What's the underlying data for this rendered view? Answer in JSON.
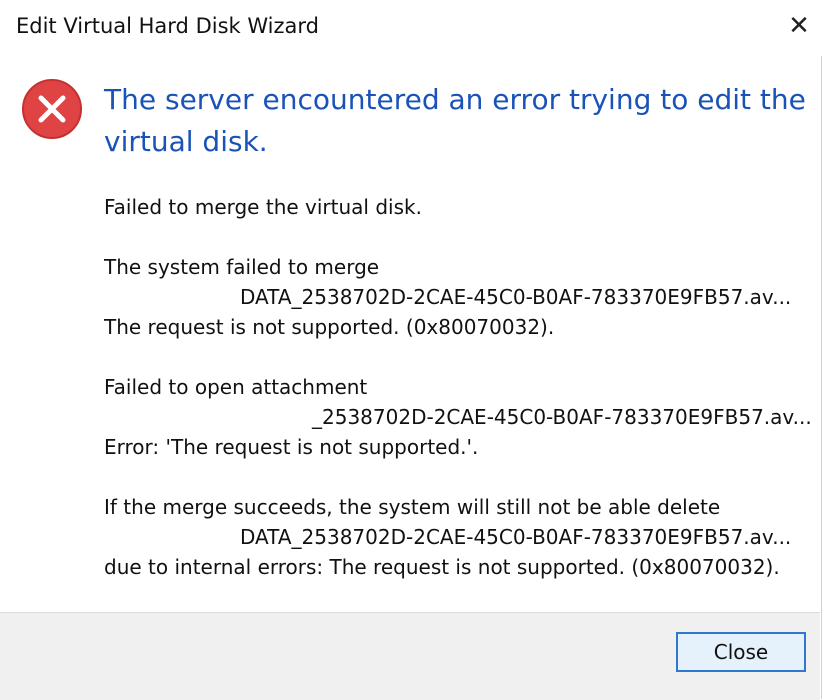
{
  "window": {
    "title": "Edit Virtual Hard Disk Wizard",
    "close_glyph": "✕"
  },
  "error": {
    "icon": "error-circle-x-icon",
    "headline": "The server encountered an error trying to edit the virtual disk."
  },
  "messages": {
    "p1": "Failed to merge the virtual disk.",
    "p2_line1": "The system failed to merge",
    "p2_line2": "DATA_2538702D-2CAE-45C0-B0AF-783370E9FB57.av...",
    "p2_line3": "The request is not supported. (0x80070032).",
    "p3_line1": "Failed to open attachment",
    "p3_line2": "_2538702D-2CAE-45C0-B0AF-783370E9FB57.av...",
    "p3_line3": "Error: 'The request is not supported.'.",
    "p4_line1": "If the merge succeeds, the system will still not be able delete",
    "p4_line2": "DATA_2538702D-2CAE-45C0-B0AF-783370E9FB57.av...",
    "p4_line3": "due to internal errors: The request is not supported. (0x80070032)."
  },
  "footer": {
    "close_label": "Close"
  },
  "colors": {
    "headline": "#1a53b8",
    "error_red": "#e04343",
    "button_border": "#2f78d0",
    "footer_bg": "#f0f0f0"
  }
}
